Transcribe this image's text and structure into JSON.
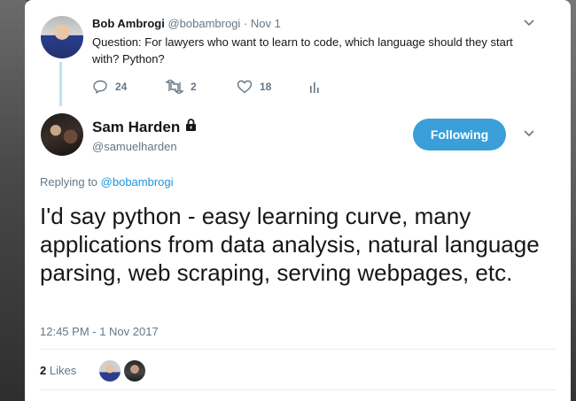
{
  "original_tweet": {
    "author_name": "Bob Ambrogi",
    "author_handle": "@bobambrogi",
    "date": "· Nov 1",
    "text": "Question: For lawyers who want to learn to code, which language should they start with? Python?",
    "reply_count": "24",
    "retweet_count": "2",
    "like_count": "18"
  },
  "reply_tweet": {
    "author_name": "Sam Harden",
    "author_handle": "@samuelharden",
    "follow_label": "Following",
    "replying_prefix": "Replying to",
    "replying_handle": "@bobambrogi",
    "text": "I'd say python - easy learning curve, many applications from data analysis, natural language parsing, web scraping, serving webpages, etc.",
    "timestamp": "12:45 PM - 1 Nov 2017",
    "likes_count": "2",
    "likes_label": "Likes"
  },
  "colors": {
    "accent": "#1da1f2",
    "follow_button": "#3a9fd8",
    "muted_text": "#657786",
    "primary_text": "#14171a",
    "thread_line": "#bfe3f5"
  },
  "icons": {
    "reply": "reply-icon",
    "retweet": "retweet-icon",
    "like": "heart-icon",
    "analytics": "analytics-icon",
    "caret": "chevron-down-icon",
    "protected": "lock-icon"
  }
}
